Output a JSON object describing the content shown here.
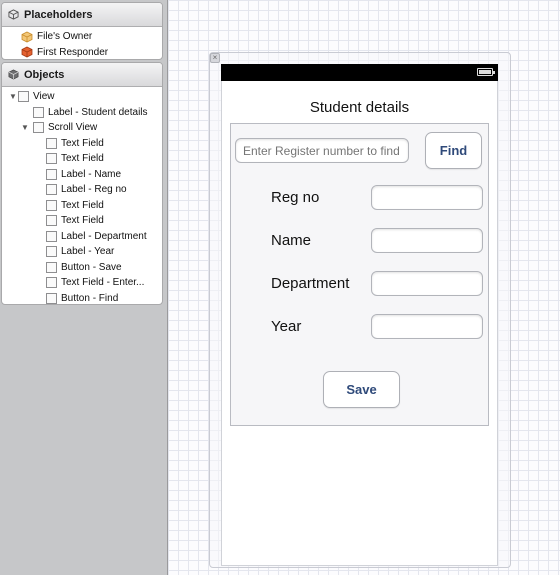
{
  "placeholders": {
    "header": "Placeholders",
    "items": [
      "File's Owner",
      "First Responder"
    ]
  },
  "objects": {
    "header": "Objects",
    "view": "View",
    "label_student_details": "Label - Student details",
    "scroll_view": "Scroll View",
    "children": [
      "Text Field",
      "Text Field",
      "Label - Name",
      "Label - Reg no",
      "Text Field",
      "Text Field",
      "Label - Department",
      "Label - Year",
      "Button - Save",
      "Text Field - Enter...",
      "Button - Find"
    ]
  },
  "screen": {
    "title": "Student details",
    "search_placeholder": "Enter Register number to find",
    "find_button": "Find",
    "labels": {
      "reg_no": "Reg no",
      "name": "Name",
      "department": "Department",
      "year": "Year"
    },
    "save_button": "Save"
  },
  "colors": {
    "button_text": "#2f4a7a",
    "status_bar": "#000000",
    "placeholder_text": "#a7a9ae"
  }
}
